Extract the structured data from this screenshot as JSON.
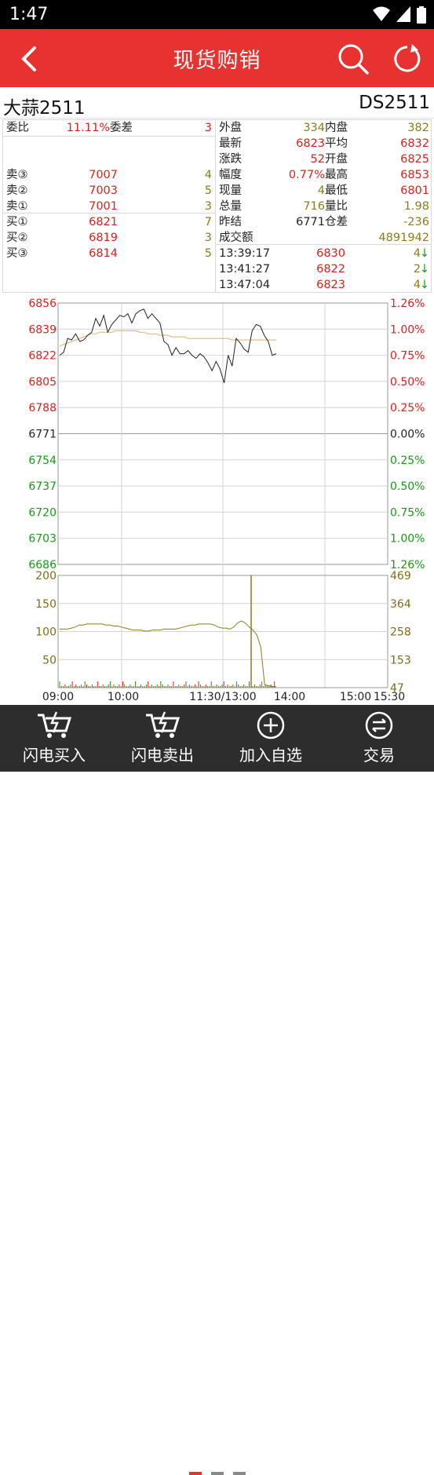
{
  "status": {
    "time": "1:47"
  },
  "appbar": {
    "title": "现货购销"
  },
  "instrument": {
    "name": "大蒜2511",
    "code": "DS2511"
  },
  "left": {
    "weibi_label": "委比",
    "weibi_value": "11.11%",
    "weicha_label": "委差",
    "weicha_value": "3",
    "asks": [
      {
        "label": "卖③",
        "price": "7007",
        "vol": "4"
      },
      {
        "label": "卖②",
        "price": "7003",
        "vol": "5"
      },
      {
        "label": "卖①",
        "price": "7001",
        "vol": "3"
      }
    ],
    "bids": [
      {
        "label": "买①",
        "price": "6821",
        "vol": "7"
      },
      {
        "label": "买②",
        "price": "6819",
        "vol": "3"
      },
      {
        "label": "买③",
        "price": "6814",
        "vol": "5"
      }
    ]
  },
  "right": {
    "rows": [
      {
        "l1": "外盘",
        "v1": "334",
        "l2": "内盘",
        "v2": "382"
      },
      {
        "l1": "最新",
        "v1": "6823",
        "l2": "平均",
        "v2": "6832"
      },
      {
        "l1": "涨跌",
        "v1": "52",
        "l2": "开盘",
        "v2": "6825"
      },
      {
        "l1": "幅度",
        "v1": "0.77%",
        "l2": "最高",
        "v2": "6853"
      },
      {
        "l1": "现量",
        "v1": "4",
        "l2": "最低",
        "v2": "6801"
      },
      {
        "l1": "总量",
        "v1": "716",
        "l2": "量比",
        "v2": "1.98"
      },
      {
        "l1": "昨结",
        "v1": "6771",
        "l2": "仓差",
        "v2": "-236"
      }
    ],
    "turnover_label": "成交额",
    "turnover_value": "4891942",
    "ticks": [
      {
        "time": "13:39:17",
        "price": "6830",
        "vol": "4",
        "dir": "↓"
      },
      {
        "time": "13:41:27",
        "price": "6822",
        "vol": "2",
        "dir": "↓"
      },
      {
        "time": "13:47:04",
        "price": "6823",
        "vol": "4",
        "dir": "↓"
      }
    ]
  },
  "chart_data": {
    "type": "line",
    "price_axis": [
      "6856",
      "6839",
      "6822",
      "6805",
      "6788",
      "6771",
      "6754",
      "6737",
      "6720",
      "6703",
      "6686"
    ],
    "pct_axis": [
      "1.26%",
      "1.00%",
      "0.75%",
      "0.50%",
      "0.25%",
      "0.00%",
      "0.25%",
      "0.50%",
      "0.75%",
      "1.00%",
      "1.26%"
    ],
    "vol_axis_left": [
      "200",
      "150",
      "100",
      "50"
    ],
    "vol_axis_right": [
      "469",
      "364",
      "258",
      "153",
      "47"
    ],
    "time_labels": [
      "09:00",
      "10:00",
      "11:30/13:00",
      "14:00",
      "15:00",
      "15:30"
    ],
    "ylim": [
      6686,
      6856
    ],
    "series": [],
    "price_line": [
      6822,
      6824,
      6833,
      6832,
      6836,
      6831,
      6832,
      6835,
      6837,
      6846,
      6841,
      6848,
      6837,
      6842,
      6845,
      6848,
      6847,
      6849,
      6843,
      6849,
      6851,
      6852,
      6846,
      6849,
      6846,
      6843,
      6831,
      6829,
      6822,
      6827,
      6823,
      6823,
      6825,
      6822,
      6820,
      6823,
      6821,
      6817,
      6812,
      6818,
      6813,
      6804,
      6822,
      6815,
      6833,
      6830,
      6826,
      6824,
      6838,
      6842,
      6841,
      6835,
      6831,
      6822,
      6823
    ],
    "avg_line": [
      6828,
      6829,
      6830,
      6831,
      6832,
      6833,
      6834,
      6835,
      6836,
      6836,
      6837,
      6837,
      6837,
      6837,
      6838,
      6838,
      6838,
      6838,
      6838,
      6838,
      6837,
      6837,
      6836,
      6836,
      6836,
      6835,
      6835,
      6835,
      6834,
      6834,
      6834,
      6834,
      6833,
      6833,
      6833,
      6833,
      6833,
      6833,
      6833,
      6833,
      6833,
      6833,
      6833,
      6832,
      6832,
      6832,
      6832,
      6832,
      6832,
      6832,
      6832,
      6832,
      6832,
      6832,
      6832
    ],
    "volume_colors": {
      "up": "#e0201c",
      "down": "#169b15"
    }
  },
  "bottom": {
    "buttons": [
      {
        "label": "闪电买入"
      },
      {
        "label": "闪电卖出"
      },
      {
        "label": "加入自选"
      },
      {
        "label": "交易"
      }
    ]
  }
}
